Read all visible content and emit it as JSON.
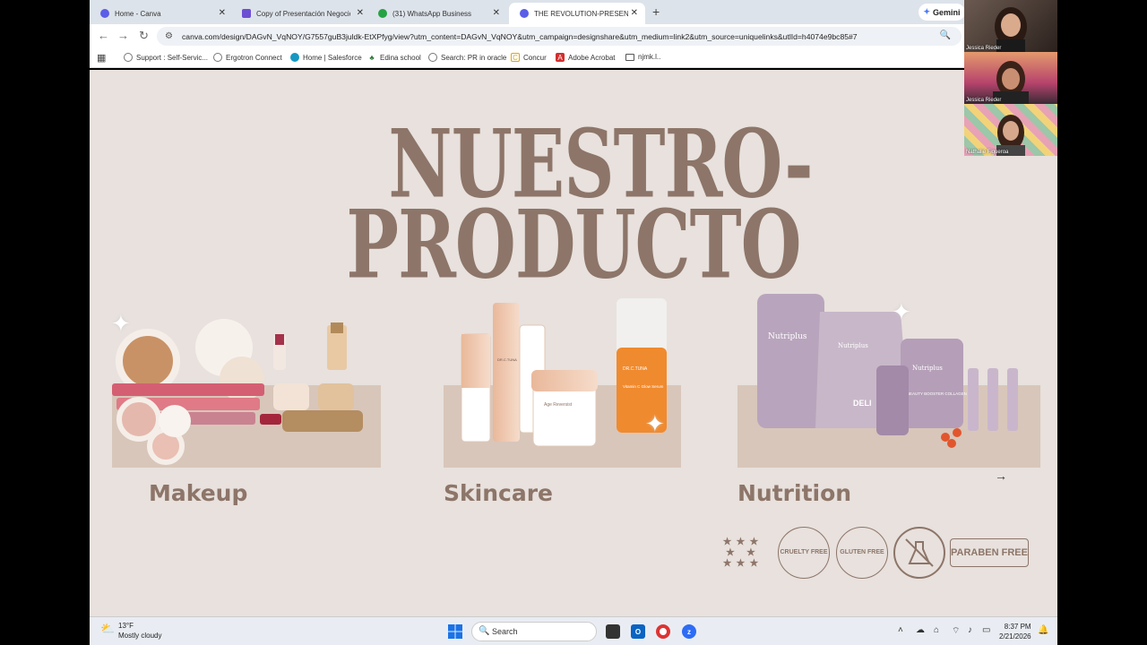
{
  "browser": {
    "tabs": [
      {
        "label": "Home - Canva",
        "color": "#5b5ee6"
      },
      {
        "label": "Copy of Presentación Negocio",
        "color": "#6d4fd3"
      },
      {
        "label": "(31) WhatsApp Business",
        "color": "#25a244"
      },
      {
        "label": "THE REVOLUTION-PRESENTACIÓ",
        "color": "#5b5ee6"
      }
    ],
    "new_tab": "+",
    "gemini_label": "Gemini",
    "url": "canva.com/design/DAGvN_VqNOY/G7557guB3juldk-EtXPfyg/view?utm_content=DAGvN_VqNOY&utm_campaign=designshare&utm_medium=link2&utm_source=uniquelinks&utlId=h4074e9bc85#7",
    "bookmarks": [
      {
        "label": "Support : Self-Servic...",
        "icon": "globe-icon"
      },
      {
        "label": "Ergotron Connect",
        "icon": "globe-icon"
      },
      {
        "label": "Home | Salesforce",
        "icon": "cloud-icon"
      },
      {
        "label": "Edina school",
        "icon": "tree-icon"
      },
      {
        "label": "Search: PR in oracle",
        "icon": "globe-icon"
      },
      {
        "label": "Concur",
        "icon": "concur-icon"
      },
      {
        "label": "Adobe Acrobat",
        "icon": "acrobat-icon"
      },
      {
        "label": "njmk.l..",
        "icon": "folder-icon"
      }
    ]
  },
  "slide": {
    "title_line1": "NUESTRO-",
    "title_line2": "PRODUCTO",
    "categories": [
      "Makeup",
      "Skincare",
      "Nutrition"
    ],
    "badges": [
      "CRUELTY FREE",
      "GLUTEN FREE",
      "PARABEN FREE"
    ],
    "product_text": {
      "drc1": "DR.C.TUNA",
      "drc2": "DR.C.TUNA",
      "serum": "Vitamin C Glow Serum",
      "age": "Age Reversist",
      "nutri1": "Nutriplus",
      "nutri2": "Nutriplus",
      "nutri3": "Nutriplus",
      "deli": "DELI",
      "collagen": "BEAUTY BOOSTER COLLAGEN"
    }
  },
  "participants": [
    {
      "name": "Jessica Rieder"
    },
    {
      "name": "Jessica Rieder"
    },
    {
      "name": "Nathalie Figueroa"
    }
  ],
  "taskbar": {
    "weather_temp": "13°F",
    "weather_desc": "Mostly cloudy",
    "search_placeholder": "Search",
    "time": "8:37 PM",
    "date": "2/21/2026"
  },
  "colors": {
    "accent": "#8d7569",
    "slide_bg": "#e8e1dd",
    "shelf": "#d8c6ba"
  }
}
